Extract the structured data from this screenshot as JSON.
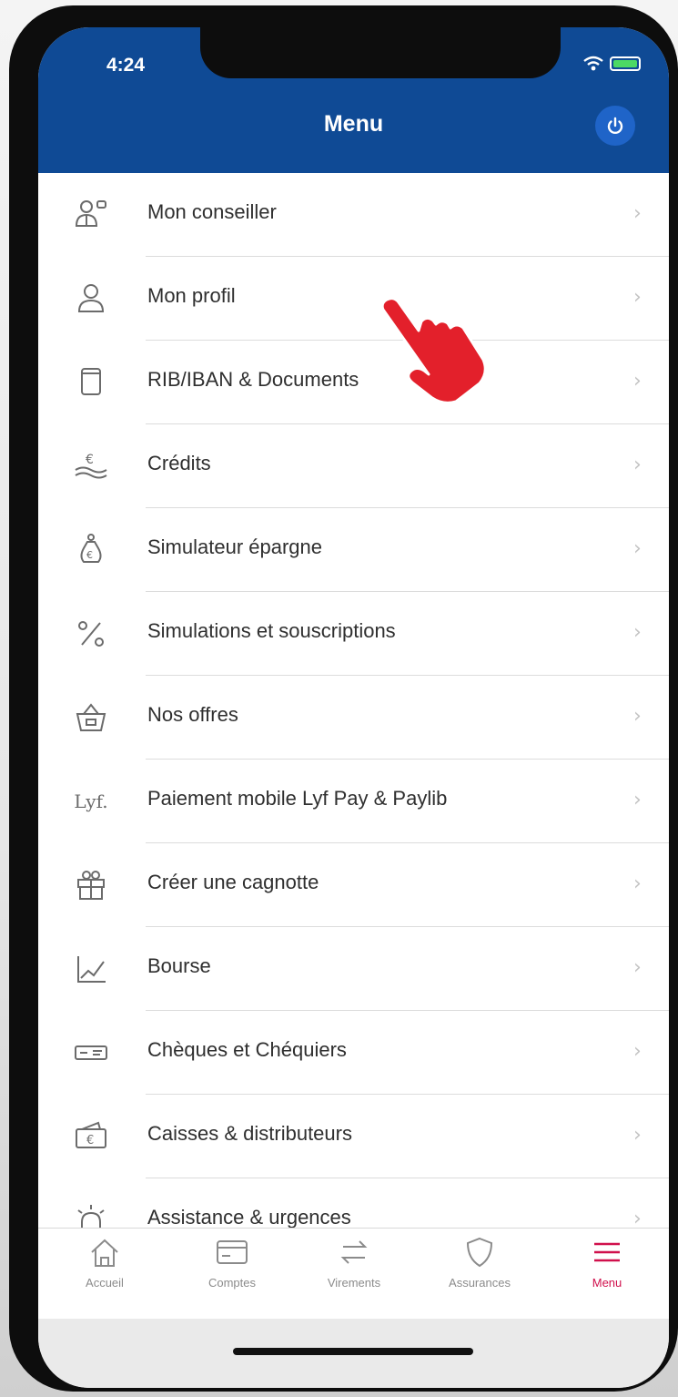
{
  "status_bar": {
    "time": "4:24"
  },
  "header": {
    "title": "Menu"
  },
  "menu": {
    "items": [
      {
        "label": "Mon conseiller",
        "icon": "advisor-icon"
      },
      {
        "label": "Mon profil",
        "icon": "profile-icon"
      },
      {
        "label": "RIB/IBAN & Documents",
        "icon": "document-icon"
      },
      {
        "label": "Crédits",
        "icon": "credit-icon"
      },
      {
        "label": "Simulateur épargne",
        "icon": "savings-icon"
      },
      {
        "label": "Simulations et souscriptions",
        "icon": "percent-icon"
      },
      {
        "label": "Nos offres",
        "icon": "basket-icon"
      },
      {
        "label": "Paiement mobile Lyf Pay & Paylib",
        "icon": "lyf-logo",
        "icon_text": "Lyf."
      },
      {
        "label": "Créer une cagnotte",
        "icon": "gift-icon"
      },
      {
        "label": "Bourse",
        "icon": "stock-chart-icon"
      },
      {
        "label": "Chèques et Chéquiers",
        "icon": "cheque-icon"
      },
      {
        "label": "Caisses & distributeurs",
        "icon": "cash-machine-icon"
      },
      {
        "label": "Assistance & urgences",
        "icon": "alarm-icon"
      }
    ],
    "chevron": "›"
  },
  "tab_bar": {
    "tabs": [
      {
        "label": "Accueil",
        "icon": "home-icon"
      },
      {
        "label": "Comptes",
        "icon": "accounts-icon"
      },
      {
        "label": "Virements",
        "icon": "transfer-icon"
      },
      {
        "label": "Assurances",
        "icon": "shield-icon"
      },
      {
        "label": "Menu",
        "icon": "hamburger-icon",
        "active": true
      }
    ]
  },
  "colors": {
    "header_blue": "#0f4a95",
    "power_button_blue": "#1f64c8",
    "active_tab": "#d0104c",
    "pointer_red": "#e3202b"
  }
}
